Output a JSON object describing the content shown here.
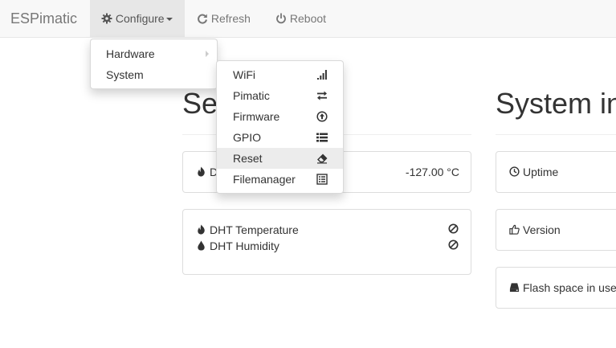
{
  "navbar": {
    "brand": "ESPimatic",
    "configure_label": "Configure",
    "refresh_label": "Refresh",
    "reboot_label": "Reboot"
  },
  "configure_menu": {
    "items": [
      {
        "label": "Hardware"
      },
      {
        "label": "System"
      }
    ]
  },
  "system_menu": {
    "items": [
      {
        "label": "WiFi",
        "icon": "signal-icon"
      },
      {
        "label": "Pimatic",
        "icon": "exchange-icon"
      },
      {
        "label": "Firmware",
        "icon": "upload-icon"
      },
      {
        "label": "GPIO",
        "icon": "list-icon"
      },
      {
        "label": "Reset",
        "icon": "eraser-icon"
      },
      {
        "label": "Filemanager",
        "icon": "file-list-icon"
      }
    ]
  },
  "sensors": {
    "title": "Se",
    "panel1": {
      "label": "D",
      "value": "-127.00 °C"
    },
    "panel2": {
      "row1": {
        "label": "DHT Temperature"
      },
      "row2": {
        "label": "DHT Humidity"
      }
    }
  },
  "system_info": {
    "title": "System in",
    "uptime_label": "Uptime",
    "version_label": "Version",
    "flash_label": "Flash space in use"
  }
}
